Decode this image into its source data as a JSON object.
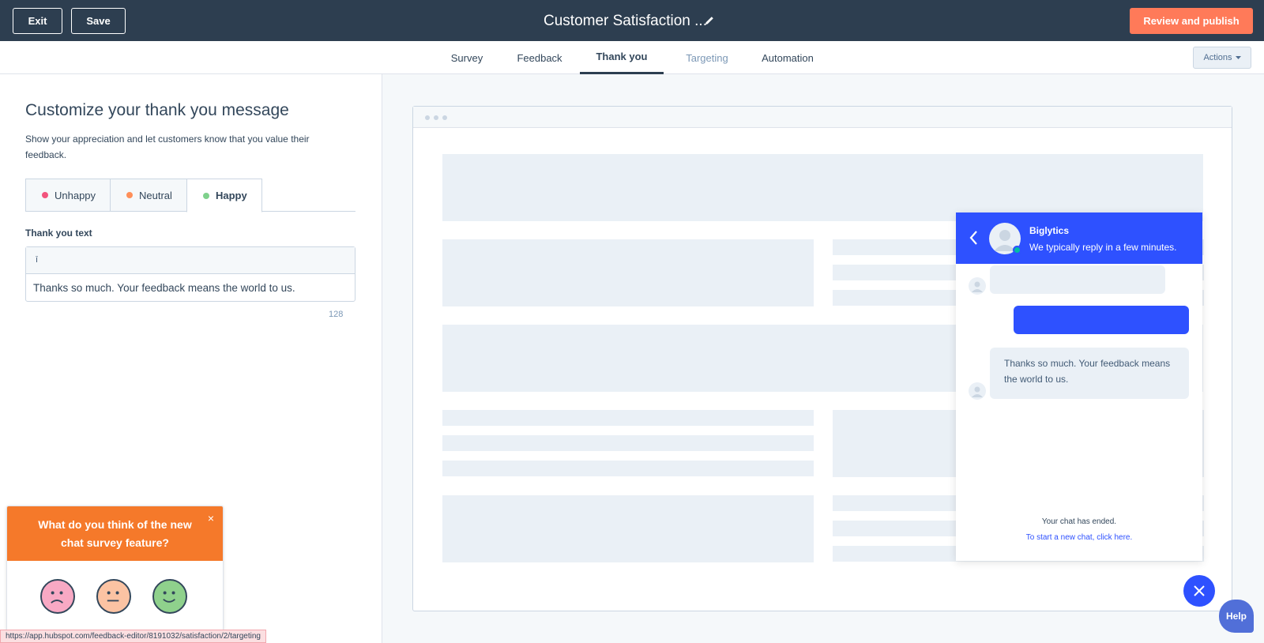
{
  "topbar": {
    "exit_label": "Exit",
    "save_label": "Save",
    "title": "Customer Satisfaction ...",
    "publish_label": "Review and publish"
  },
  "tabs": [
    {
      "label": "Survey"
    },
    {
      "label": "Feedback"
    },
    {
      "label": "Thank you"
    },
    {
      "label": "Targeting"
    },
    {
      "label": "Automation"
    }
  ],
  "actions_label": "Actions",
  "panel": {
    "heading": "Customize your thank you message",
    "description": "Show your appreciation and let customers know that you value their feedback.",
    "sentiments": [
      {
        "label": "Unhappy",
        "color": "#f2547d"
      },
      {
        "label": "Neutral",
        "color": "#ff8f59"
      },
      {
        "label": "Happy",
        "color": "#00bda5"
      }
    ],
    "field_label": "Thank you text",
    "personalize_token": "ī",
    "thank_you_text": "Thanks so much. Your feedback means the world to us.",
    "char_count": "128"
  },
  "survey_popup": {
    "question": "What do you think of the new chat survey feature?",
    "close_glyph": "×",
    "faces": [
      {
        "icon": "sad-face-icon",
        "color": "#f8a9c4"
      },
      {
        "icon": "neutral-face-icon",
        "color": "#fbc3a3"
      },
      {
        "icon": "happy-face-icon",
        "color": "#8fd18c"
      }
    ]
  },
  "status_url": "https://app.hubspot.com/feedback-editor/8191032/satisfaction/2/targeting",
  "chat": {
    "company": "Biglytics",
    "subtitle": "We typically reply in a few minutes.",
    "message": "Thanks so much. Your feedback means the world to us.",
    "ended_text": "Your chat has ended.",
    "new_chat_link": "To start a new chat, click here.",
    "accent": "#2e51ff"
  },
  "help_label": "Help"
}
